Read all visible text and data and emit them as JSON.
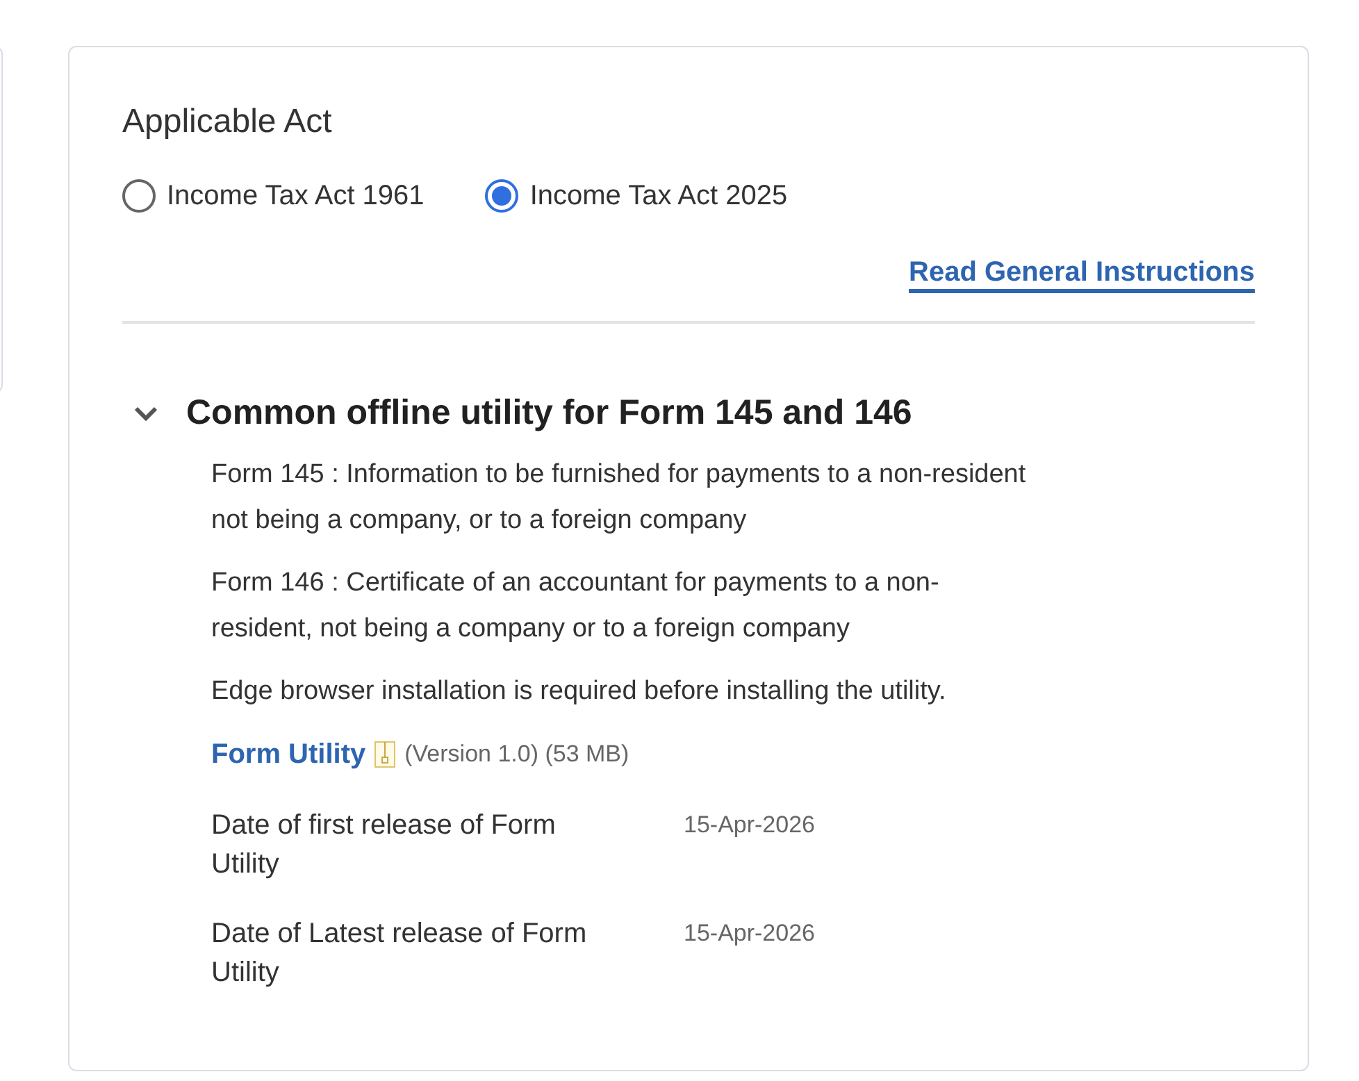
{
  "applicable_act": {
    "title": "Applicable Act",
    "options": [
      {
        "label": "Income Tax Act 1961",
        "selected": false
      },
      {
        "label": "Income Tax Act 2025",
        "selected": true
      }
    ],
    "instructions_link": "Read General Instructions"
  },
  "section": {
    "title": "Common offline utility for Form 145 and 146",
    "expanded": true,
    "descriptions": [
      "Form 145 : Information to be furnished for payments to a non-resident not being a company, or to a foreign company",
      "Form 146 : Certificate of an accountant for payments to a non-resident, not being a company or to a foreign company",
      "Edge browser installation is required before installing the utility."
    ],
    "download": {
      "link": "Form Utility",
      "details": "(Version 1.0) (53 MB)"
    },
    "dates": [
      {
        "label": "Date of first release of Form Utility",
        "value": "15-Apr-2026"
      },
      {
        "label": "Date of Latest release of Form Utility",
        "value": "15-Apr-2026"
      }
    ]
  }
}
